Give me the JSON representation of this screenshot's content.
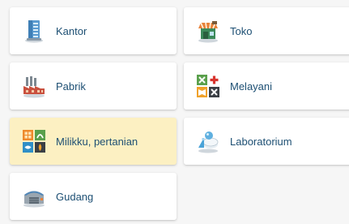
{
  "tiles": [
    {
      "label": "Kantor",
      "icon": "office-building-icon",
      "selected": false
    },
    {
      "label": "Toko",
      "icon": "shop-icon",
      "selected": false
    },
    {
      "label": "Pabrik",
      "icon": "factory-icon",
      "selected": false
    },
    {
      "label": "Melayani",
      "icon": "services-icon",
      "selected": false
    },
    {
      "label": "Milikku, pertanian",
      "icon": "farm-icon",
      "selected": true
    },
    {
      "label": "Laboratorium",
      "icon": "laboratory-icon",
      "selected": false
    },
    {
      "label": "Gudang",
      "icon": "warehouse-icon",
      "selected": false
    }
  ],
  "colors": {
    "label_text": "#1d4f73",
    "selected_background": "#fcf0c2",
    "tile_background": "#ffffff",
    "page_background": "#f6f6f6"
  }
}
